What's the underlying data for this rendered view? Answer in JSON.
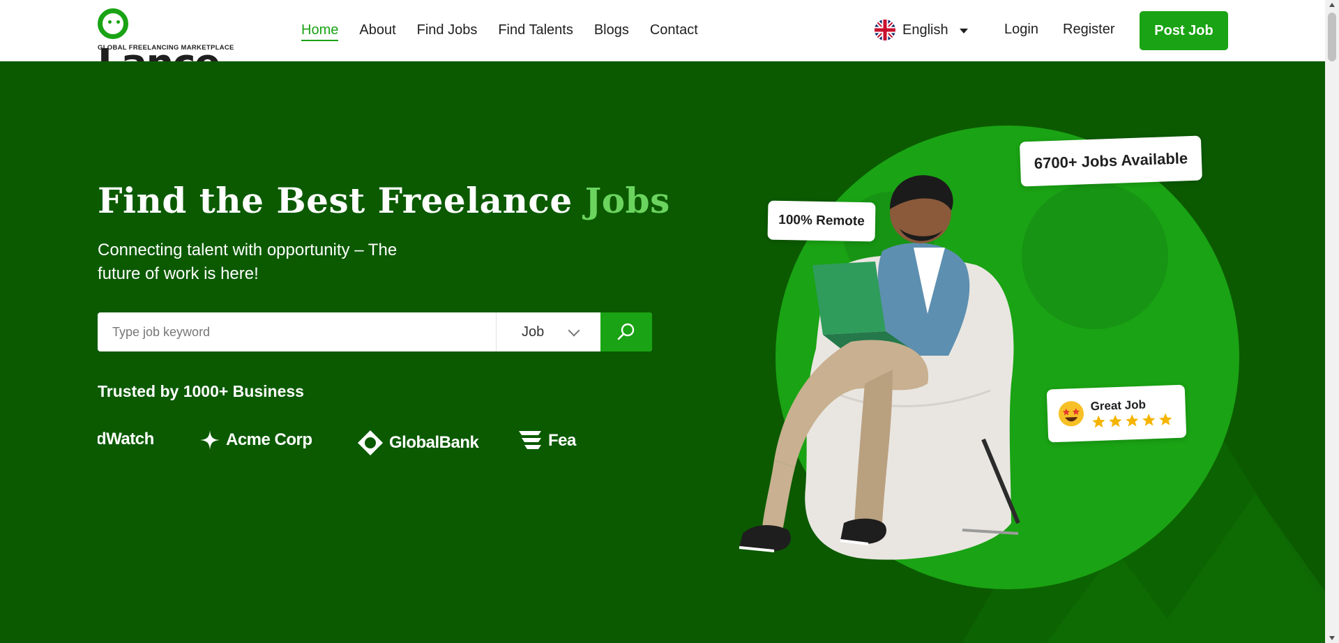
{
  "header": {
    "logo": {
      "word": "Lance",
      "tagline": "GLOBAL FREELANCING MARKETPLACE"
    },
    "nav": [
      {
        "label": "Home",
        "active": true
      },
      {
        "label": "About"
      },
      {
        "label": "Find Jobs"
      },
      {
        "label": "Find Talents"
      },
      {
        "label": "Blogs"
      },
      {
        "label": "Contact"
      }
    ],
    "language": {
      "label": "English",
      "icon": "uk-flag-icon"
    },
    "login_label": "Login",
    "register_label": "Register",
    "post_job_label": "Post Job"
  },
  "hero": {
    "title_main": "Find the Best Freelance",
    "title_accent": "Jobs",
    "subtitle": "Connecting talent with opportunity – The future of work is here!",
    "search": {
      "placeholder": "Type job keyword",
      "value": "",
      "category": "Job"
    },
    "trusted_label": "Trusted by 1000+ Business",
    "partner_logos": [
      "dWatch",
      "Acme Corp",
      "GlobalBank",
      "Fea"
    ],
    "badges": {
      "remote": "100% Remote",
      "jobs": "6700+ Jobs Available",
      "great_job": "Great Job",
      "rating": 5
    }
  },
  "colors": {
    "brand_green": "#1aa314",
    "hero_background": "#0b5a00",
    "accent_title": "#6bd45e"
  }
}
